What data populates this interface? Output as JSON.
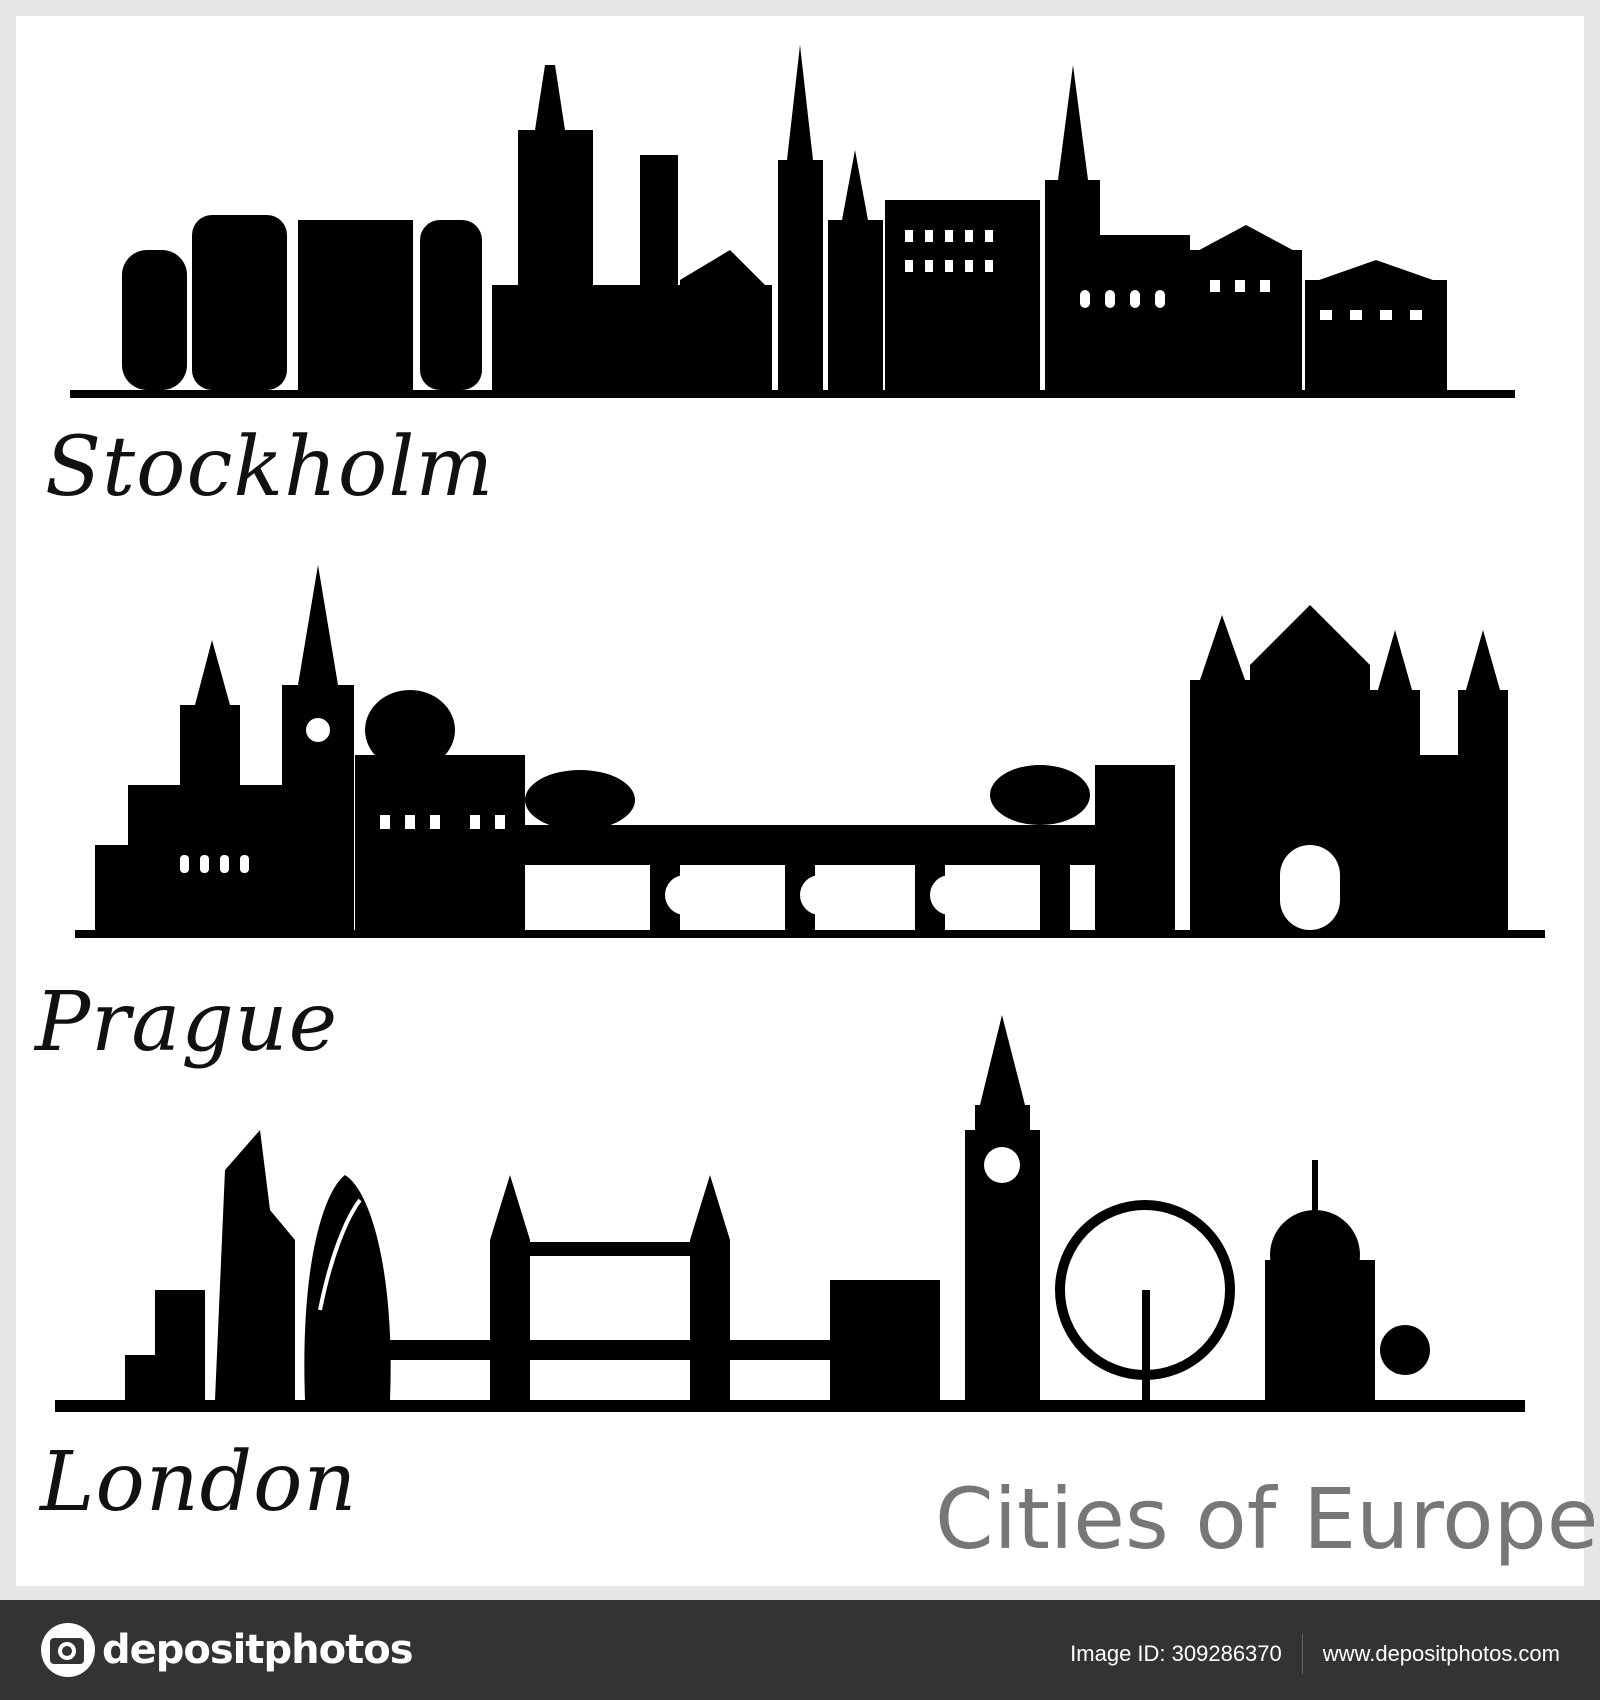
{
  "cities": [
    {
      "name": "Stockholm"
    },
    {
      "name": "Prague"
    },
    {
      "name": "London"
    }
  ],
  "tagline": "Cities of Europe",
  "footer": {
    "brand": "depositphotos",
    "image_id": "Image ID: 309286370",
    "website": "www.depositphotos.com"
  },
  "colors": {
    "silhouette": "#000000",
    "tagline": "#777777",
    "footer_bg": "#333333",
    "border": "#e6e6e6"
  }
}
